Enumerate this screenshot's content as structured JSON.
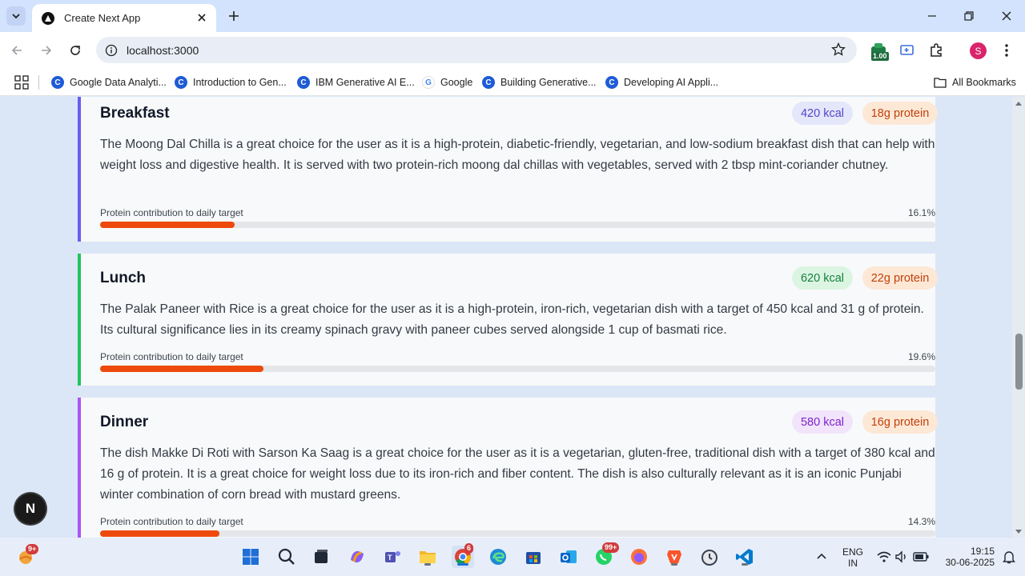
{
  "browser": {
    "tab_title": "Create Next App",
    "url": "localhost:3000",
    "extension_badge": "1.00",
    "profile_initial": "S",
    "bookmarks": [
      {
        "label": "Google Data Analyti..."
      },
      {
        "label": "Introduction to Gen..."
      },
      {
        "label": "IBM Generative AI E..."
      },
      {
        "label": "Google"
      },
      {
        "label": "Building Generative..."
      },
      {
        "label": "Developing AI Appli..."
      }
    ],
    "all_bookmarks": "All Bookmarks"
  },
  "meals": [
    {
      "title": "Breakfast",
      "kcal": "420 kcal",
      "protein": "18g protein",
      "description": "The Moong Dal Chilla is a great choice for the user as it is a high-protein, diabetic-friendly, vegetarian, and low-sodium breakfast dish that can help with weight loss and digestive health. It is served with two protein-rich moong dal chillas with vegetables, served with 2 tbsp mint-coriander chutney.",
      "progress_label": "Protein contribution to daily target",
      "progress_text": "16.1%",
      "progress_value": 16.1,
      "accent": "#6a5cf0",
      "kcal_bg": "#e4e7fb",
      "kcal_color": "#4f46c8"
    },
    {
      "title": "Lunch",
      "kcal": "620 kcal",
      "protein": "22g protein",
      "description": "The Palak Paneer with Rice is a great choice for the user as it is a high-protein, iron-rich, vegetarian dish with a target of 450 kcal and 31 g of protein. Its cultural significance lies in its creamy spinach gravy with paneer cubes served alongside 1 cup of basmati rice.",
      "progress_label": "Protein contribution to daily target",
      "progress_text": "19.6%",
      "progress_value": 19.6,
      "accent": "#22c55e",
      "kcal_bg": "#dcf5e3",
      "kcal_color": "#15803d"
    },
    {
      "title": "Dinner",
      "kcal": "580 kcal",
      "protein": "16g protein",
      "description": "The dish Makke Di Roti with Sarson Ka Saag is a great choice for the user as it is a vegetarian, gluten-free, traditional dish with a target of 380 kcal and 16 g of protein. It is a great choice for weight loss due to its iron-rich and fiber content. The dish is also culturally relevant as it is an iconic Punjabi winter combination of corn bread with mustard greens.",
      "progress_label": "Protein contribution to daily target",
      "progress_text": "14.3%",
      "progress_value": 14.3,
      "accent": "#a855f7",
      "kcal_bg": "#f1e4fb",
      "kcal_color": "#7e22ce"
    }
  ],
  "colors": {
    "protein_bg": "#fde8d6",
    "protein_color": "#c2410c",
    "progress_fill": "#ee4a0e"
  },
  "next_badge": "N",
  "taskbar": {
    "weather_badge": "9+",
    "chrome_badge": "6",
    "whatsapp_badge": "99+",
    "language_line1": "ENG",
    "language_line2": "IN",
    "time": "19:15",
    "date": "30-06-2025"
  }
}
